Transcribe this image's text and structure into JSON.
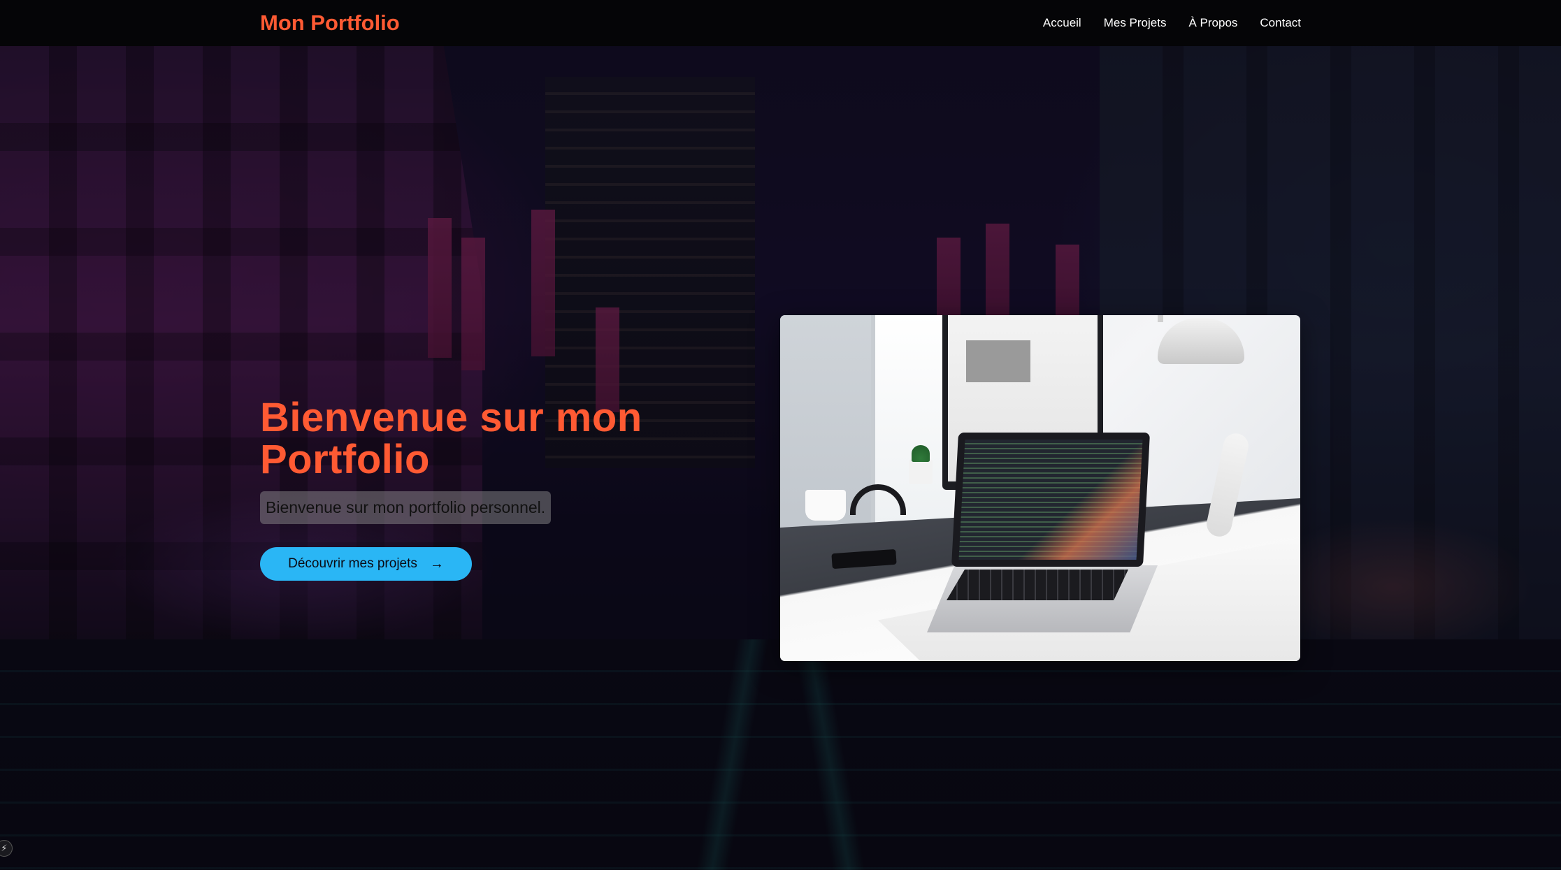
{
  "navbar": {
    "brand": "Mon Portfolio",
    "links": [
      {
        "label": "Accueil"
      },
      {
        "label": "Mes Projets"
      },
      {
        "label": "À Propos"
      },
      {
        "label": "Contact"
      }
    ]
  },
  "hero": {
    "title": "Bienvenue sur mon Portfolio",
    "subtitle": "Bienvenue sur mon portfolio personnel.",
    "cta_label": "Découvrir mes projets",
    "cta_icon": "arrow-right-icon",
    "image_icon": "laptop-desk-photo"
  },
  "corner_badge_icon": "bolt-icon",
  "colors": {
    "accent": "#ff5a33",
    "button": "#2ab6f5",
    "navbar_bg": "#050507",
    "nav_text": "#ffffff"
  }
}
